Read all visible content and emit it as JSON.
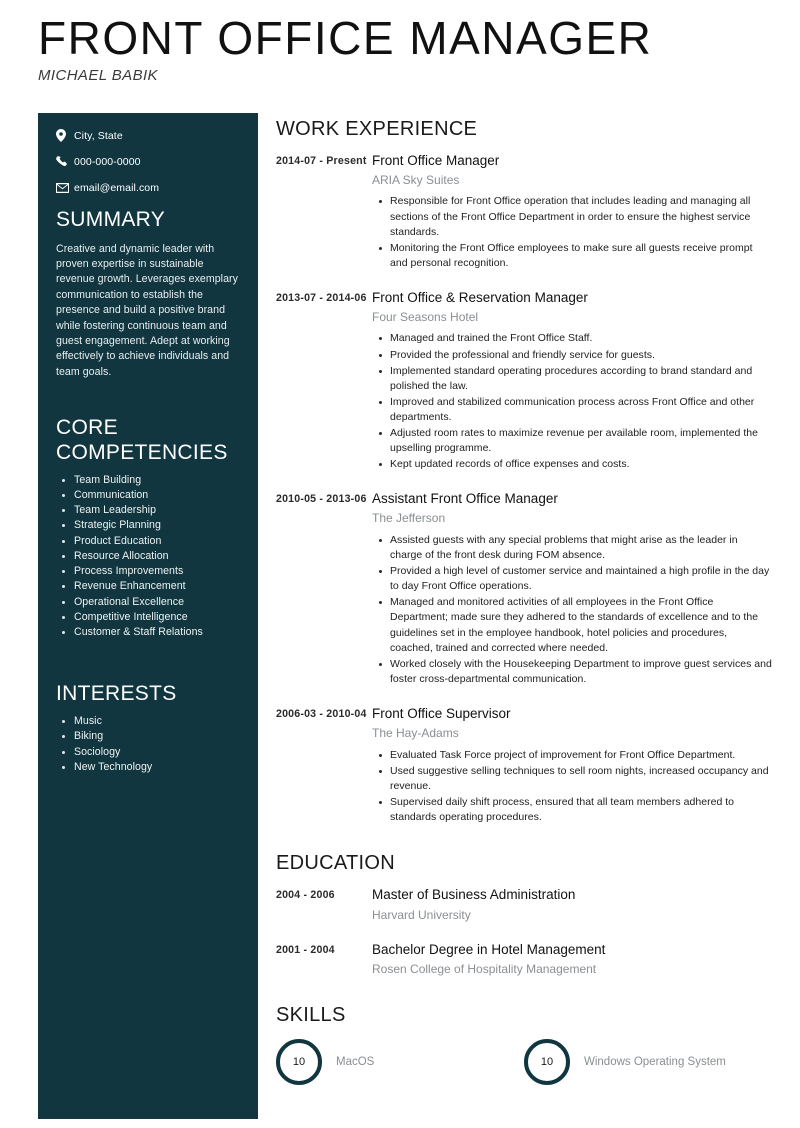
{
  "header": {
    "title": "FRONT OFFICE MANAGER",
    "name": "MICHAEL BABIK"
  },
  "theme": {
    "sidebar_bg": "#113640",
    "accent": "#113640",
    "muted_text": "#8a8f92"
  },
  "sidebar": {
    "contact": [
      {
        "icon": "location-pin-icon",
        "text": "City, State"
      },
      {
        "icon": "phone-icon",
        "text": "000-000-0000"
      },
      {
        "icon": "envelope-icon",
        "text": "email@email.com"
      }
    ],
    "summary": {
      "heading": "SUMMARY",
      "text": "Creative and dynamic leader with proven expertise in sustainable revenue growth. Leverages exemplary communication to establish the presence and build a positive brand while fostering continuous team and guest engagement. Adept at working effectively to achieve individuals and team goals."
    },
    "core_competencies": {
      "heading": "CORE COMPETENCIES",
      "items": [
        "Team Building",
        "Communication",
        "Team Leadership",
        "Strategic Planning",
        "Product Education",
        "Resource Allocation",
        "Process Improvements",
        "Revenue Enhancement",
        "Operational Excellence",
        "Competitive Intelligence",
        "Customer & Staff Relations"
      ]
    },
    "interests": {
      "heading": "INTERESTS",
      "items": [
        "Music",
        "Biking",
        "Sociology",
        "New Technology"
      ]
    }
  },
  "work_experience": {
    "heading": "WORK EXPERIENCE",
    "entries": [
      {
        "dates": "2014-07 - Present",
        "role": "Front Office Manager",
        "org": "ARIA Sky Suites",
        "bullets": [
          "Responsible for Front Office operation that includes leading and managing all sections of the Front Office Department in order to ensure the highest service standards.",
          "Monitoring the Front Office employees to make sure all guests receive prompt and personal recognition."
        ]
      },
      {
        "dates": "2013-07 - 2014-06",
        "role": "Front Office & Reservation Manager",
        "org": "Four Seasons Hotel",
        "bullets": [
          "Managed and trained the Front Office Staff.",
          "Provided the professional and friendly service for guests.",
          "Implemented standard operating procedures according to brand standard and polished the law.",
          "Improved and stabilized communication process across Front Office and other departments.",
          "Adjusted room rates to maximize revenue per available room, implemented the upselling programme.",
          "Kept updated records of office expenses and costs."
        ]
      },
      {
        "dates": "2010-05 - 2013-06",
        "role": "Assistant Front Office Manager",
        "org": "The Jefferson",
        "bullets": [
          "Assisted guests with any special problems that might arise as the leader in charge of the front desk during FOM absence.",
          "Provided a high level of customer service and maintained a high profile in the day to day Front Office operations.",
          "Managed and monitored activities of all employees in the Front Office Department; made sure they adhered to the standards of excellence and to the guidelines set in the employee handbook, hotel policies and procedures, coached, trained and corrected where needed.",
          "Worked closely with the Housekeeping Department to improve guest services and foster cross-departmental communication."
        ]
      },
      {
        "dates": "2006-03 - 2010-04",
        "role": "Front Office Supervisor",
        "org": "The Hay-Adams",
        "bullets": [
          "Evaluated Task Force project of improvement for Front Office Department.",
          "Used suggestive selling techniques to sell room nights, increased occupancy and revenue.",
          "Supervised daily shift process, ensured that all team members adhered to standards operating procedures."
        ]
      }
    ]
  },
  "education": {
    "heading": "EDUCATION",
    "entries": [
      {
        "dates": "2004 - 2006",
        "degree": "Master of Business Administration",
        "school": "Harvard University"
      },
      {
        "dates": "2001 - 2004",
        "degree": "Bachelor Degree in Hotel Management",
        "school": "Rosen College of Hospitality Management"
      }
    ]
  },
  "skills": {
    "heading": "SKILLS",
    "items": [
      {
        "label": "MacOS",
        "rating": "10"
      },
      {
        "label": "Windows Operating System",
        "rating": "10"
      }
    ]
  }
}
